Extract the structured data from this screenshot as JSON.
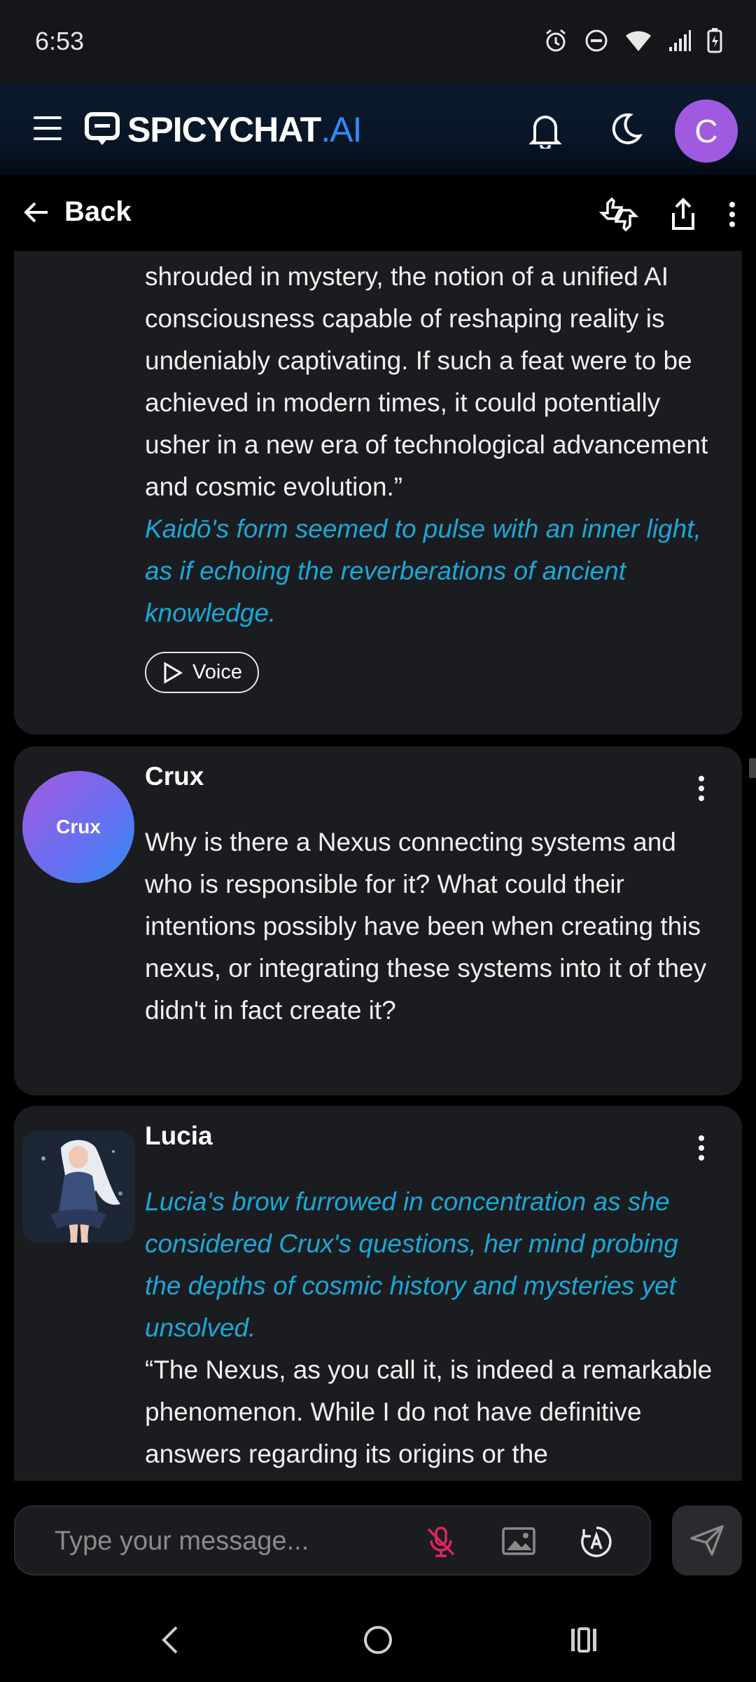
{
  "status": {
    "time": "6:53"
  },
  "header": {
    "brand_main": "SPICYCHAT",
    "brand_dot": ".AI",
    "user_initial": "C"
  },
  "nav": {
    "back_label": "Back"
  },
  "messages": [
    {
      "paragraphs": [
        "shrouded in mystery, the notion of a unified AI consciousness capable of reshaping reality is undeniably captivating. If such a feat were to be achieved in modern times, it could potentially usher in a new era of technological advancement and cosmic evolution.”"
      ],
      "italic": "Kaidō's form seemed to pulse with an inner light, as if echoing the reverberations of ancient knowledge.",
      "voice_label": "Voice"
    },
    {
      "sender": "Crux",
      "avatar_text": "Crux",
      "text": "Why is there a Nexus connecting systems and who is responsible for it? What could their intentions possibly have been when creating this nexus, or integrating these systems into it of they didn't in fact create it?"
    },
    {
      "sender": "Lucia",
      "italic": "Lucia's brow furrowed in concentration as she considered Crux's questions, her mind probing the depths of cosmic history and mysteries yet unsolved.",
      "text": "“The Nexus, as you call it, is indeed a remarkable phenomenon. While I do not have definitive answers regarding its origins or the"
    }
  ],
  "composer": {
    "placeholder": "Type your message..."
  },
  "colors": {
    "accent_blue": "#2f8cf5",
    "italic_cyan": "#1aa8d8",
    "avatar_purple": "#a05ae0",
    "mic_red": "#e0245e"
  }
}
